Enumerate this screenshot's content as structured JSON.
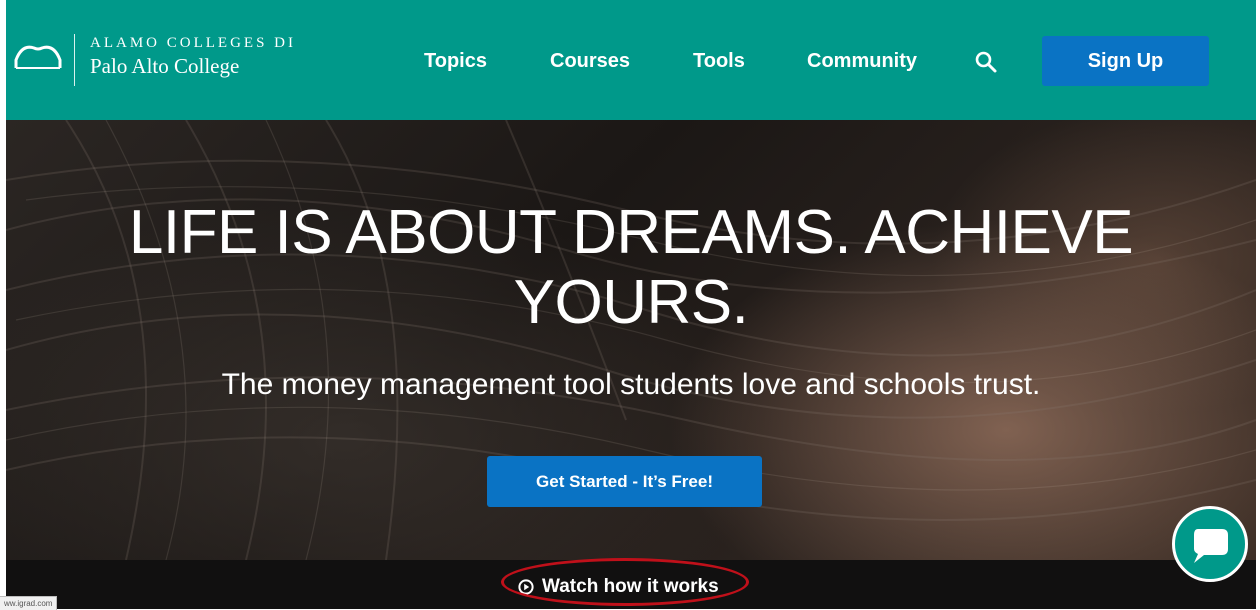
{
  "header": {
    "logo": {
      "line1": "ALAMO COLLEGES DI",
      "line2": "Palo Alto College"
    },
    "nav": [
      {
        "label": "Topics"
      },
      {
        "label": "Courses"
      },
      {
        "label": "Tools"
      },
      {
        "label": "Community"
      }
    ],
    "search_icon": "search-icon",
    "signup_label": "Sign Up",
    "colors": {
      "bar": "#00998a",
      "button": "#0a73c4"
    }
  },
  "hero": {
    "title": "LIFE IS ABOUT DREAMS. ACHIEVE YOURS.",
    "subtitle": "The money management tool students love and schools trust.",
    "cta_label": "Get Started - It’s Free!"
  },
  "watch": {
    "label": "Watch how it works",
    "icon": "play-circle-icon",
    "highlight_color": "#c0101a"
  },
  "chat": {
    "icon": "chat-bubble-icon"
  },
  "status_bar": {
    "url": "ww.igrad.com"
  }
}
